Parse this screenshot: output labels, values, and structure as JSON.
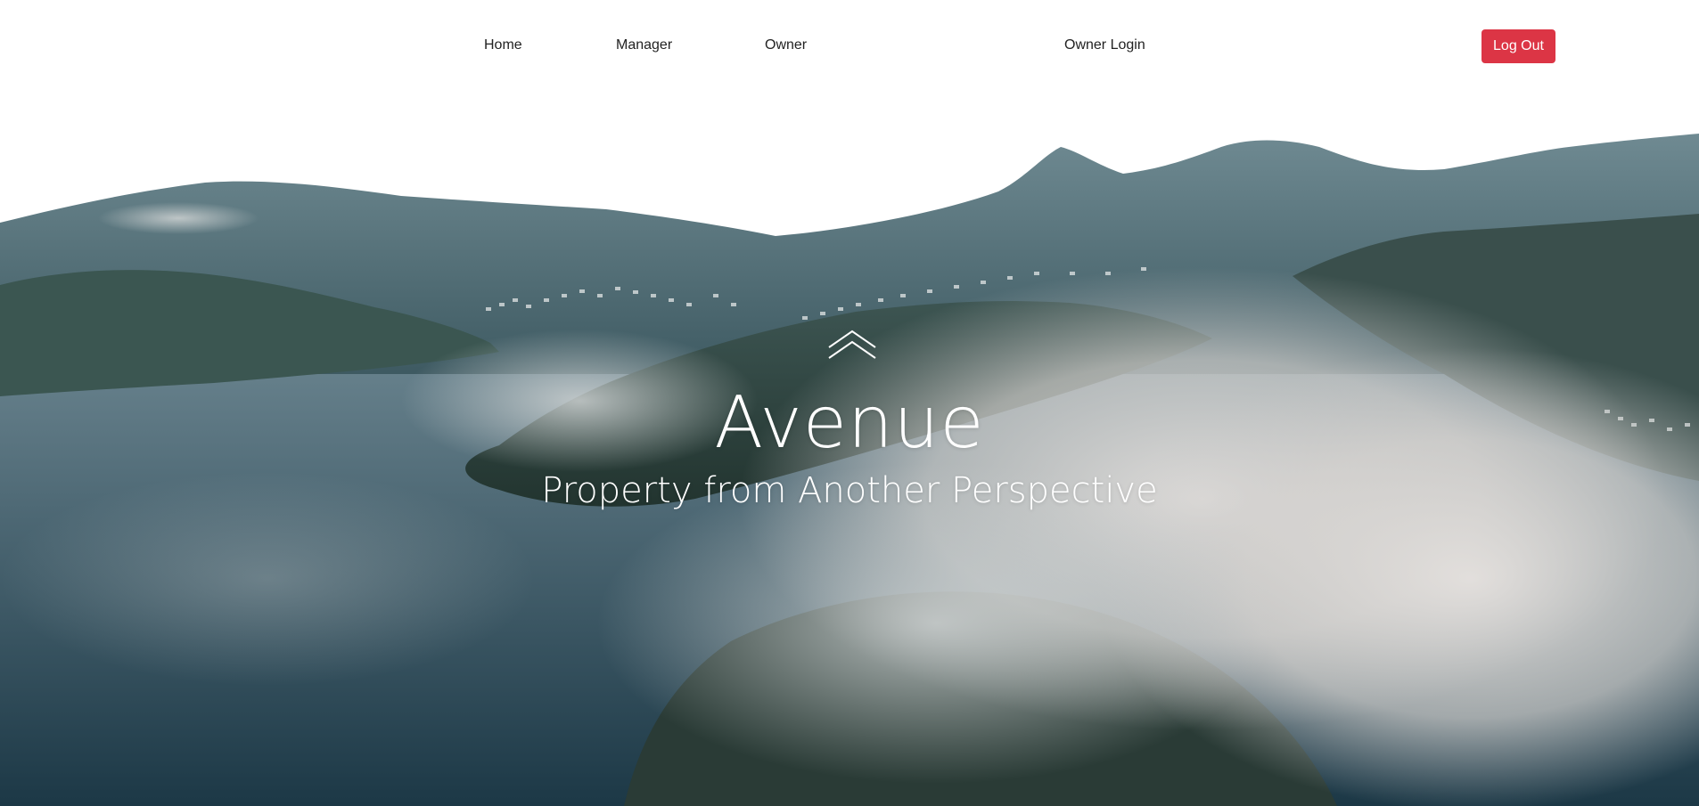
{
  "nav": {
    "items": [
      {
        "label": "Home"
      },
      {
        "label": "Manager"
      },
      {
        "label": "Owner"
      },
      {
        "label": "Owner Login"
      }
    ],
    "logout_label": "Log Out",
    "logout_color": "#dc3545"
  },
  "hero": {
    "icon": "double-chevron-up-icon",
    "title": "Avenue",
    "subtitle": "Property from Another Perspective"
  }
}
